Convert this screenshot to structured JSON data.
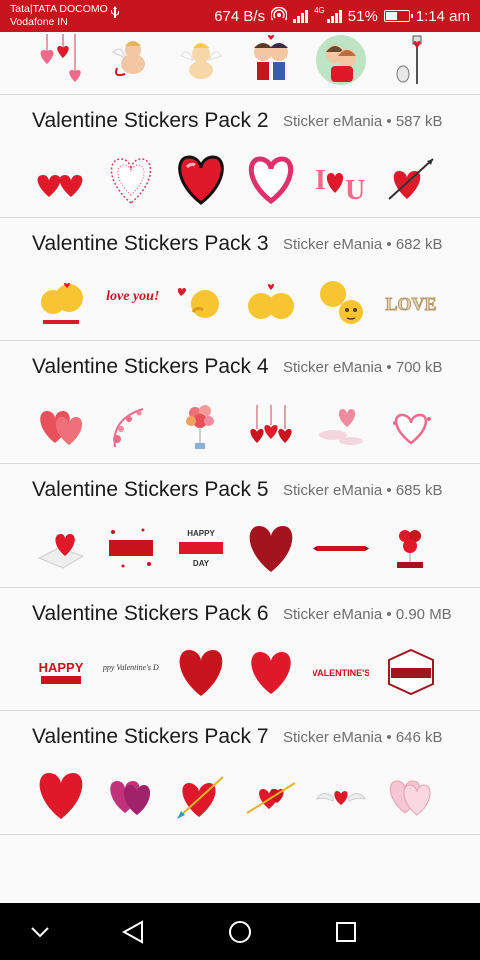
{
  "status_bar": {
    "carrier_line1": "Tata|TATA DOCOMO",
    "carrier_line2": "Vodafone IN",
    "usb_icon": "usb-icon",
    "data_speed": "674 B/s",
    "hotspot_icon": "hotspot-icon",
    "network_4g": "4G",
    "battery_percent": "51%",
    "battery_level": 0.51,
    "time": "1:14 am"
  },
  "packs": [
    {
      "name": "Valentine Stickers Pack 2",
      "author": "Sticker eMania",
      "size": "587 kB"
    },
    {
      "name": "Valentine Stickers Pack 3",
      "author": "Sticker eMania",
      "size": "682 kB"
    },
    {
      "name": "Valentine Stickers Pack 4",
      "author": "Sticker eMania",
      "size": "700 kB"
    },
    {
      "name": "Valentine Stickers Pack 5",
      "author": "Sticker eMania",
      "size": "685 kB"
    },
    {
      "name": "Valentine Stickers Pack 6",
      "author": "Sticker eMania",
      "size": "0.90 MB"
    },
    {
      "name": "Valentine Stickers Pack 7",
      "author": "Sticker eMania",
      "size": "646 kB"
    }
  ],
  "separator": "•",
  "sticker_text": {
    "love": "I love you!!",
    "happy": "HAPPY",
    "valentines_day": "Valentine's day",
    "happy_valentines": "Happy Valentine's Day!",
    "happy_vday": "Happy Valentine's Day",
    "valentines_caps": "VALENTINE'S",
    "day": "DAY",
    "love_word": "LOVE",
    "u_letter": "U",
    "i_letter": "I"
  },
  "nav": {
    "collapse_icon": "chevron-down-icon",
    "back_icon": "back-triangle-icon",
    "home_icon": "home-circle-icon",
    "recents_icon": "recents-square-icon"
  },
  "colors": {
    "status_bar": "#c8141c",
    "heart_red": "#e0192a",
    "heart_pink": "#f06a8a"
  }
}
